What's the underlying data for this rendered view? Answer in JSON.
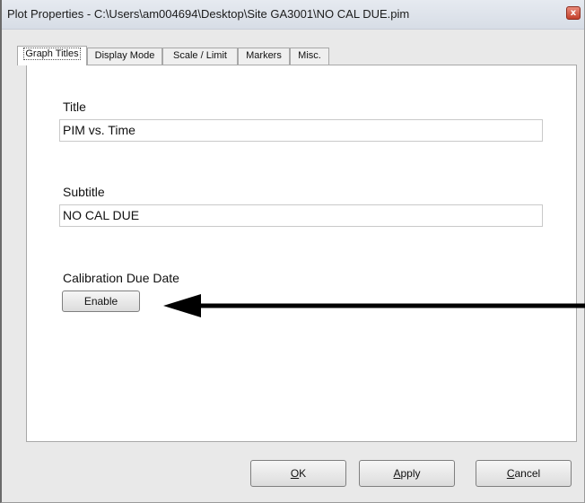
{
  "window": {
    "title": "Plot Properties - C:\\Users\\am004694\\Desktop\\Site GA3001\\NO CAL DUE.pim",
    "close_symbol": "x"
  },
  "tabs": [
    {
      "label": "Graph Titles",
      "active": true
    },
    {
      "label": "Display Mode",
      "active": false
    },
    {
      "label": "Scale / Limit",
      "active": false
    },
    {
      "label": "Markers",
      "active": false
    },
    {
      "label": "Misc.",
      "active": false
    }
  ],
  "graph_titles": {
    "title_label": "Title",
    "title_value": "PIM vs. Time",
    "subtitle_label": "Subtitle",
    "subtitle_value": "NO CAL DUE",
    "calibration_label": "Calibration Due Date",
    "enable_button": "Enable"
  },
  "buttons": {
    "ok": {
      "mnemonic": "O",
      "rest": "K"
    },
    "apply": {
      "mnemonic": "A",
      "rest": "pply"
    },
    "cancel": {
      "mnemonic": "C",
      "rest": "ancel"
    }
  },
  "annotation": {
    "icon": "arrow-left",
    "color": "#000000"
  }
}
